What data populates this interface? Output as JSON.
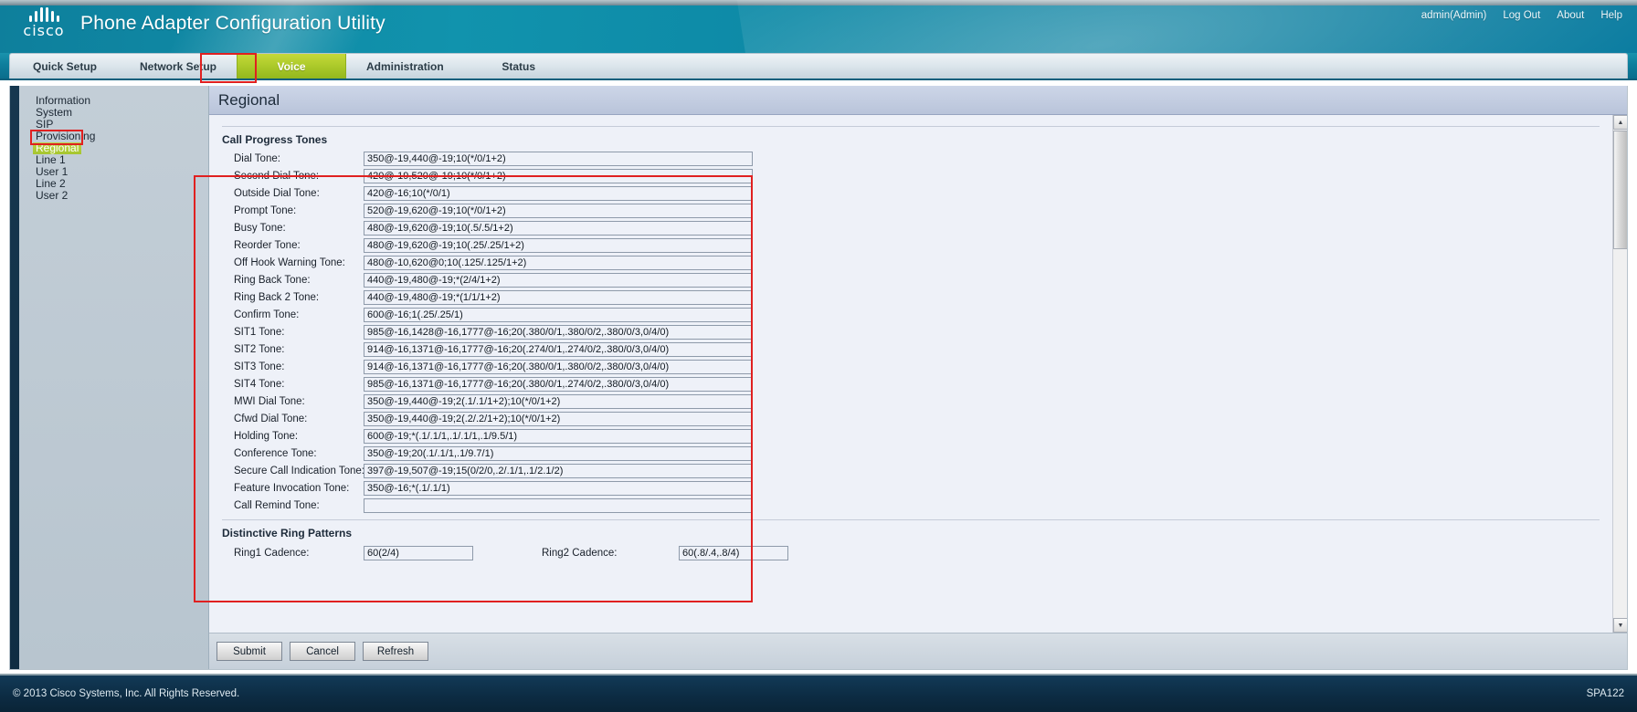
{
  "header": {
    "logo_text": "cisco",
    "title": "Phone Adapter Configuration Utility",
    "links": [
      {
        "label": "admin(Admin)",
        "name": "user-link"
      },
      {
        "label": "Log Out",
        "name": "logout-link"
      },
      {
        "label": "About",
        "name": "about-link"
      },
      {
        "label": "Help",
        "name": "help-link"
      }
    ]
  },
  "nav": {
    "tabs": [
      {
        "label": "Quick Setup",
        "active": false
      },
      {
        "label": "Network Setup",
        "active": false
      },
      {
        "label": "Voice",
        "active": true
      },
      {
        "label": "Administration",
        "active": false
      },
      {
        "label": "Status",
        "active": false
      }
    ]
  },
  "sidebar": {
    "items": [
      {
        "label": "Information",
        "active": false
      },
      {
        "label": "System",
        "active": false
      },
      {
        "label": "SIP",
        "active": false
      },
      {
        "label": "Provisioning",
        "active": false
      },
      {
        "label": "Regional",
        "active": true
      },
      {
        "label": "Line 1",
        "active": false
      },
      {
        "label": "User 1",
        "active": false
      },
      {
        "label": "Line 2",
        "active": false
      },
      {
        "label": "User 2",
        "active": false
      }
    ]
  },
  "panel": {
    "title": "Regional",
    "call_progress_tones": {
      "heading": "Call Progress Tones",
      "fields": [
        {
          "label": "Dial Tone:",
          "value": "350@-19,440@-19;10(*/0/1+2)"
        },
        {
          "label": "Second Dial Tone:",
          "value": "420@-19,520@-19;10(*/0/1+2)"
        },
        {
          "label": "Outside Dial Tone:",
          "value": "420@-16;10(*/0/1)"
        },
        {
          "label": "Prompt Tone:",
          "value": "520@-19,620@-19;10(*/0/1+2)"
        },
        {
          "label": "Busy Tone:",
          "value": "480@-19,620@-19;10(.5/.5/1+2)"
        },
        {
          "label": "Reorder Tone:",
          "value": "480@-19,620@-19;10(.25/.25/1+2)"
        },
        {
          "label": "Off Hook Warning Tone:",
          "value": "480@-10,620@0;10(.125/.125/1+2)"
        },
        {
          "label": "Ring Back Tone:",
          "value": "440@-19,480@-19;*(2/4/1+2)"
        },
        {
          "label": "Ring Back 2 Tone:",
          "value": "440@-19,480@-19;*(1/1/1+2)"
        },
        {
          "label": "Confirm Tone:",
          "value": "600@-16;1(.25/.25/1)"
        },
        {
          "label": "SIT1 Tone:",
          "value": "985@-16,1428@-16,1777@-16;20(.380/0/1,.380/0/2,.380/0/3,0/4/0)"
        },
        {
          "label": "SIT2 Tone:",
          "value": "914@-16,1371@-16,1777@-16;20(.274/0/1,.274/0/2,.380/0/3,0/4/0)"
        },
        {
          "label": "SIT3 Tone:",
          "value": "914@-16,1371@-16,1777@-16;20(.380/0/1,.380/0/2,.380/0/3,0/4/0)"
        },
        {
          "label": "SIT4 Tone:",
          "value": "985@-16,1371@-16,1777@-16;20(.380/0/1,.274/0/2,.380/0/3,0/4/0)"
        },
        {
          "label": "MWI Dial Tone:",
          "value": "350@-19,440@-19;2(.1/.1/1+2);10(*/0/1+2)"
        },
        {
          "label": "Cfwd Dial Tone:",
          "value": "350@-19,440@-19;2(.2/.2/1+2);10(*/0/1+2)"
        },
        {
          "label": "Holding Tone:",
          "value": "600@-19;*(.1/.1/1,.1/.1/1,.1/9.5/1)"
        },
        {
          "label": "Conference Tone:",
          "value": "350@-19;20(.1/.1/1,.1/9.7/1)"
        },
        {
          "label": "Secure Call Indication Tone:",
          "value": "397@-19,507@-19;15(0/2/0,.2/.1/1,.1/2.1/2)"
        },
        {
          "label": "Feature Invocation Tone:",
          "value": "350@-16;*(.1/.1/1)"
        },
        {
          "label": "Call Remind Tone:",
          "value": ""
        }
      ]
    },
    "distinctive_ring_patterns": {
      "heading": "Distinctive Ring Patterns",
      "ring1": {
        "label": "Ring1 Cadence:",
        "value": "60(2/4)"
      },
      "ring2": {
        "label": "Ring2 Cadence:",
        "value": "60(.8/.4,.8/4)"
      }
    }
  },
  "buttons": {
    "submit": "Submit",
    "cancel": "Cancel",
    "refresh": "Refresh"
  },
  "footer": {
    "copyright": "© 2013 Cisco Systems, Inc. All Rights Reserved.",
    "model": "SPA122"
  },
  "colors": {
    "accent_teal": "#0e7f9c",
    "highlight_green": "#a6c62f",
    "annotation_red": "#e02020",
    "footer_navy": "#0c2b42"
  }
}
